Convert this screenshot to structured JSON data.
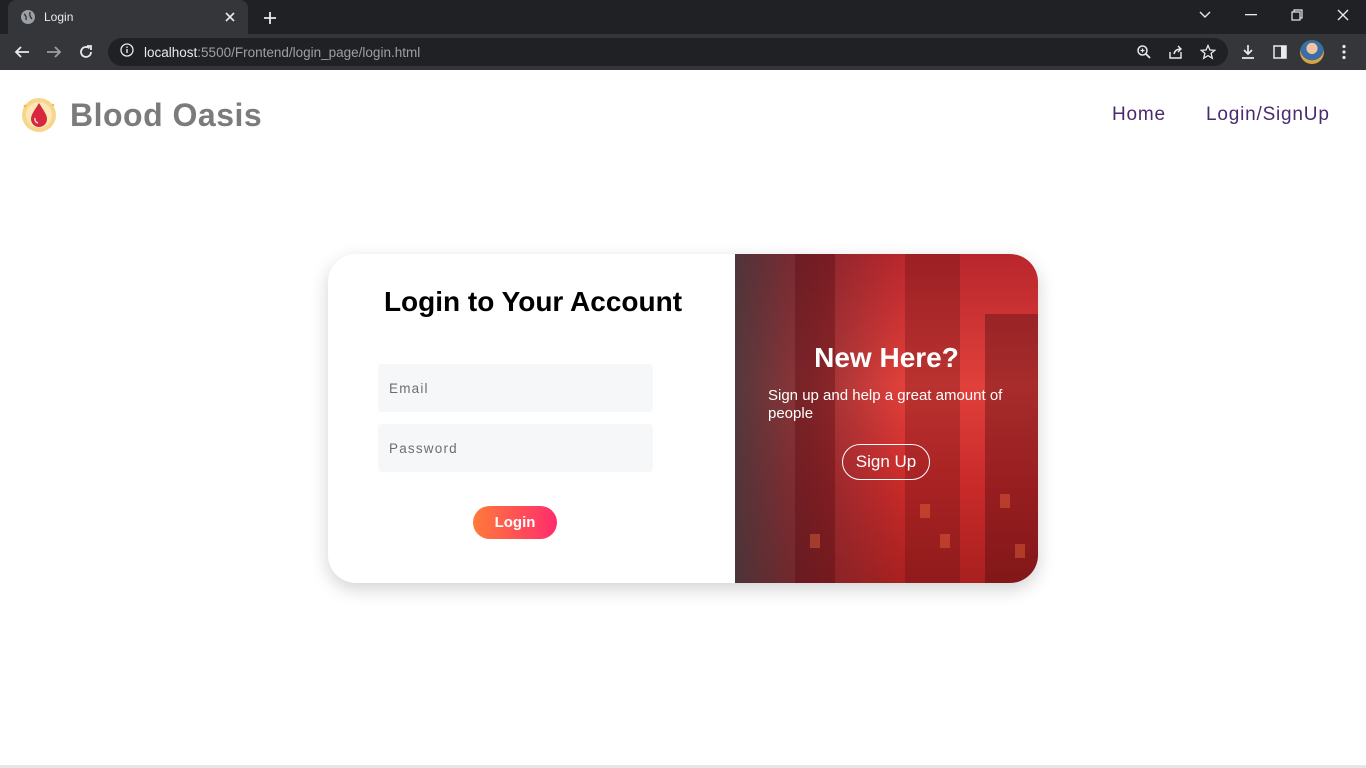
{
  "browser": {
    "tab_title": "Login",
    "url_host": "localhost",
    "url_path": ":5500/Frontend/login_page/login.html"
  },
  "navbar": {
    "brand_name": "Blood Oasis",
    "links": [
      {
        "label": "Home"
      },
      {
        "label": "Login/SignUp"
      }
    ],
    "link_color": "#4a2a6e"
  },
  "login": {
    "title": "Login to Your Account",
    "email_placeholder": "Email",
    "password_placeholder": "Password",
    "button_label": "Login",
    "button_gradient": [
      "#ff7a3a",
      "#ff2d6c"
    ]
  },
  "signup_panel": {
    "title": "New Here?",
    "subtitle": "Sign up and help a great amount of people",
    "button_label": "Sign Up"
  }
}
